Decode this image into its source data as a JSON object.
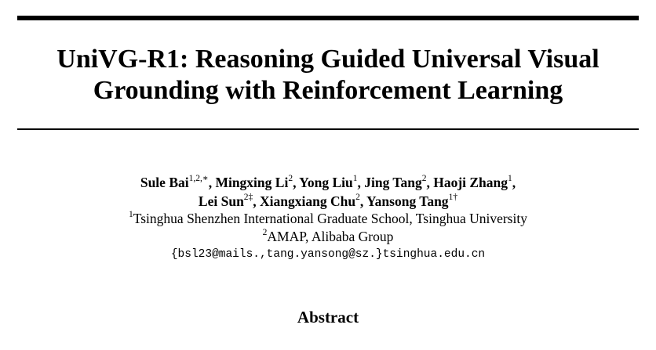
{
  "paper": {
    "title_lines": [
      "UniVG-R1: Reasoning Guided Universal Visual",
      "Grounding with Reinforcement Learning"
    ],
    "authors": [
      {
        "name": "Sule Bai",
        "marks": "1,2,∗"
      },
      {
        "name": "Mingxing Li",
        "marks": "2"
      },
      {
        "name": "Yong Liu",
        "marks": "1"
      },
      {
        "name": "Jing Tang",
        "marks": "2"
      },
      {
        "name": "Haoji Zhang",
        "marks": "1"
      },
      {
        "name": "Lei Sun",
        "marks": "2‡"
      },
      {
        "name": "Xiangxiang Chu",
        "marks": "2"
      },
      {
        "name": "Yansong Tang",
        "marks": "1†"
      }
    ],
    "affiliations": [
      {
        "mark": "1",
        "text": "Tsinghua Shenzhen International Graduate School, Tsinghua University"
      },
      {
        "mark": "2",
        "text": "AMAP, Alibaba Group"
      }
    ],
    "email": "{bsl23@mails.,tang.yansong@sz.}tsinghua.edu.cn",
    "abstract_heading": "Abstract"
  }
}
